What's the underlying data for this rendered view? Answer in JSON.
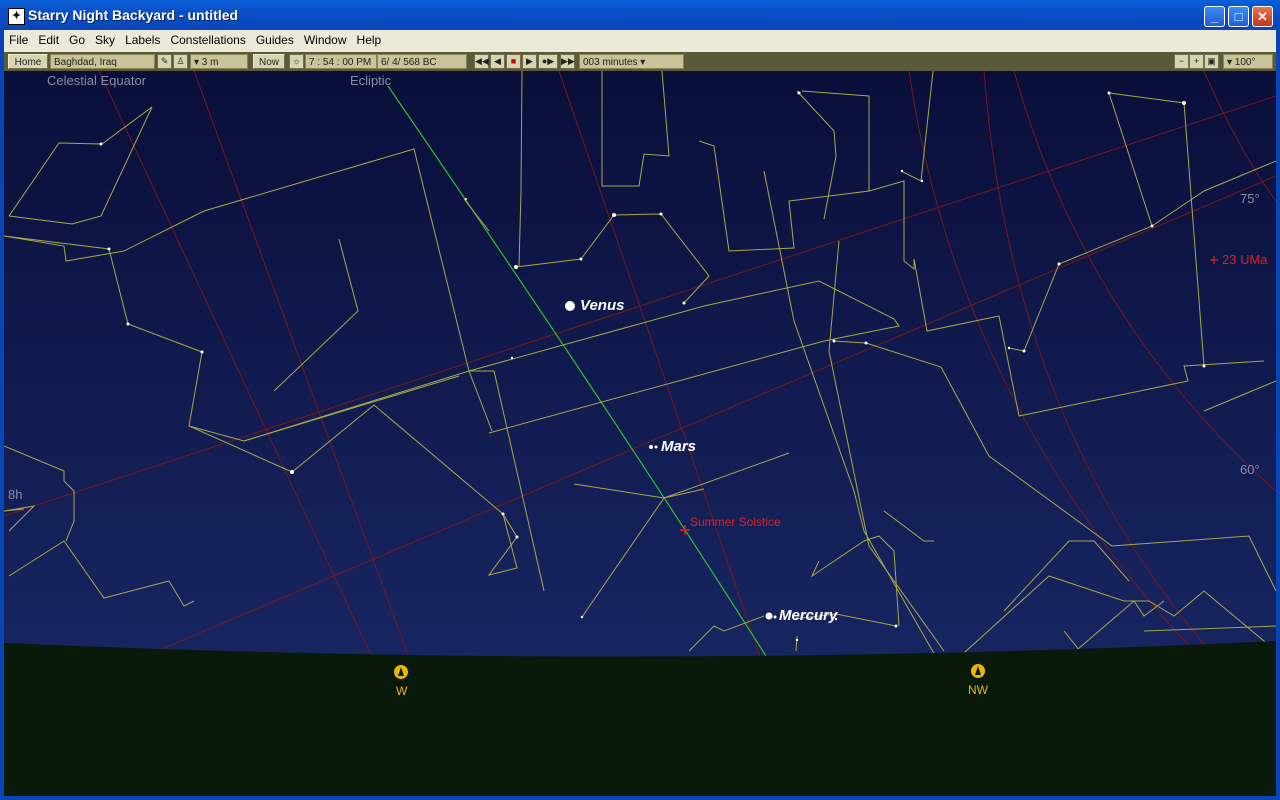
{
  "window": {
    "title": "Starry Night Backyard - untitled",
    "minimize": "_",
    "maximize": "□",
    "close": "✕"
  },
  "menu": [
    "File",
    "Edit",
    "Go",
    "Sky",
    "Labels",
    "Constellations",
    "Guides",
    "Window",
    "Help"
  ],
  "toolbar": {
    "home_label": "Home",
    "location": "Baghdad, Iraq",
    "elevation": "▾ 3 m",
    "now_label": "Now",
    "time": "7 : 54 : 00 PM",
    "date": "6/  4/   568 BC",
    "time_step": "003 minutes ▾",
    "fov": "▾ 100°"
  },
  "sky_labels": {
    "celestial_equator": "Celestial Equator",
    "ecliptic": "Ecliptic",
    "dec_75": "75°",
    "dec_60": "60°",
    "ra_8h": "8h",
    "star_23uma": "23 UMa",
    "summer_solstice": "Summer Solstice",
    "venus": "Venus",
    "mars": "Mars",
    "mercury": "Mercury",
    "compass_w": "W",
    "compass_nw": "NW"
  },
  "colors": {
    "sky_top": "#0a0f3a",
    "sky_bottom": "#1a2a6a",
    "ground": "#0a1a0a",
    "constellation_line": "#b8b850",
    "grid_red": "#7a1818",
    "ecliptic_green": "#30c030",
    "label_red": "#e02020",
    "compass_yellow": "#e8b800"
  }
}
